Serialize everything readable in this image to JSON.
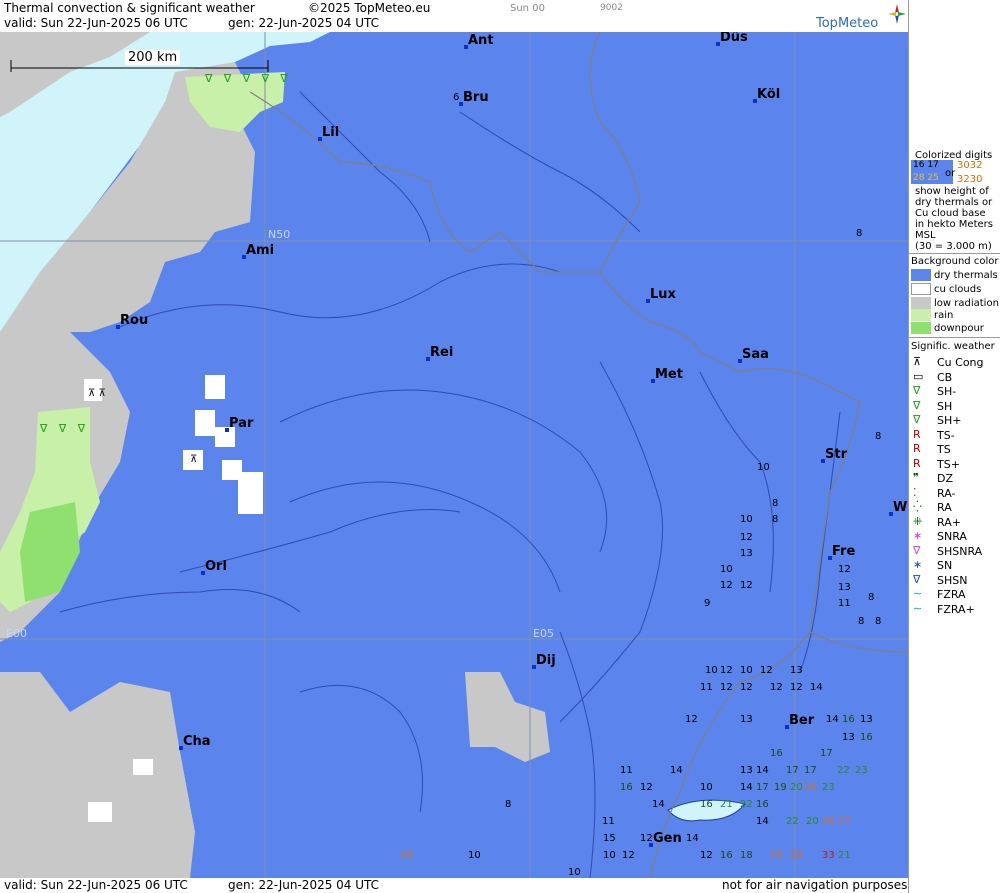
{
  "header": {
    "title": "Thermal convection & significant weather",
    "copyright": "©2025 TopMeteo.eu",
    "step_label": "Sun 00",
    "code": "9002",
    "valid": "valid:  Sun  22-Jun-2025  06 UTC",
    "gen": "gen: 22-Jun-2025 04 UTC",
    "logo": "TopMeteo"
  },
  "map": {
    "scale_label": "200 km",
    "grid_labels": [
      "N50",
      "E00",
      "E05"
    ],
    "colors": {
      "dry": "#5b84ed",
      "cu": "#ffffff",
      "low": "#c8c8c8",
      "rain": "#c8f0a8",
      "downpour": "#90e070",
      "sea": "#d0f4fa"
    },
    "cities": [
      "Ant",
      "Düs",
      "Bru",
      "Köl",
      "Lil",
      "Ami",
      "Lux",
      "Rou",
      "Rei",
      "Saa",
      "Met",
      "Par",
      "Str",
      "W",
      "Fre",
      "Orl",
      "Dij",
      "Ber",
      "Cha",
      "Gen"
    ],
    "digits": [
      "6",
      "8",
      "8",
      "8",
      "10",
      "8",
      "8",
      "10",
      "12",
      "13",
      "10",
      "12",
      "12",
      "9",
      "12",
      "13",
      "11",
      "8",
      "8",
      "10",
      "12",
      "10",
      "12",
      "13",
      "11",
      "12",
      "12",
      "12",
      "12",
      "14",
      "12",
      "13",
      "14",
      "16",
      "13",
      "13",
      "16",
      "16",
      "17",
      "11",
      "14",
      "10",
      "13",
      "14",
      "17",
      "17",
      "22",
      "23",
      "16",
      "12",
      "14",
      "17",
      "19",
      "20",
      "26",
      "23",
      "11",
      "14",
      "16",
      "21",
      "22",
      "16",
      "15",
      "12",
      "14",
      "22",
      "20",
      "26",
      "27",
      "28",
      "10",
      "10",
      "10",
      "12",
      "12",
      "16",
      "18",
      "25",
      "28",
      "33",
      "21",
      "14",
      "8"
    ],
    "weather_rows": [
      "∇ ∇ ∇ ∇ ∇",
      "∇ ∇ ∇",
      "⊼ ⊼",
      "⊼"
    ]
  },
  "legend": {
    "colorized_title": "Colorized digits",
    "sample_a": "16 17",
    "sample_b": "28 25",
    "sample_or": "or",
    "sample_c": "3032",
    "sample_d": "3230",
    "desc": [
      "show height of",
      "dry thermals or",
      "Cu cloud base",
      "in hekto Meters",
      "MSL",
      "(30 = 3.000 m)"
    ],
    "bg_title": "Background color",
    "bg_items": [
      "dry thermals",
      "cu clouds",
      "low radiation",
      "rain",
      "downpour"
    ],
    "sig_title": "Signific. weather",
    "sig_items": [
      "Cu Cong",
      "CB",
      "SH-",
      "SH",
      "SH+",
      "TS-",
      "TS",
      "TS+",
      "DZ",
      "RA-",
      "RA",
      "RA+",
      "SNRA",
      "SHSNRA",
      "SN",
      "SHSN",
      "FZRA",
      "FZRA+"
    ],
    "sig_icons": [
      "⊼",
      "▭",
      "∇",
      "∇",
      "∇",
      "R",
      "R",
      "R",
      "❞",
      "⁚",
      "⁛",
      "⁜",
      "∗",
      "∇",
      "∗",
      "∇",
      "∼",
      "∼"
    ],
    "sig_colors": [
      "#000",
      "#000",
      "#1a9a1a",
      "#1a9a1a",
      "#1a9a1a",
      "#b00000",
      "#b00000",
      "#b00000",
      "#006000",
      "#006000",
      "#006000",
      "#006000",
      "#cc44cc",
      "#cc44cc",
      "#2244cc",
      "#2244cc",
      "#00b0c0",
      "#00b0c0"
    ]
  },
  "footer": {
    "valid": "valid:  Sun  22-Jun-2025  06 UTC",
    "gen": "gen: 22-Jun-2025 04 UTC",
    "note": "not for air navigation purposes"
  }
}
